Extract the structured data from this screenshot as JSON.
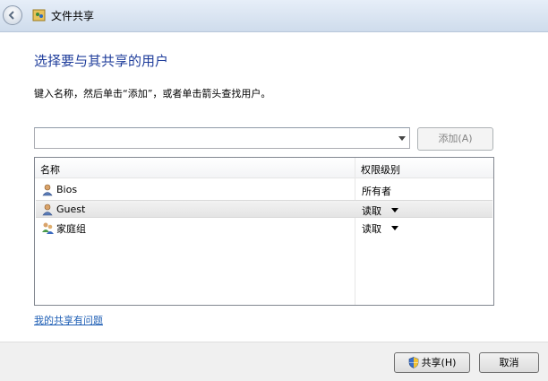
{
  "window": {
    "title": "文件共享"
  },
  "dialog": {
    "heading": "选择要与其共享的用户",
    "instruction": "键入名称，然后单击“添加”，或者单击箭头查找用户。",
    "combo_value": "",
    "add_button": "添加(A)",
    "columns": {
      "name": "名称",
      "permission": "权限级别"
    },
    "rows": [
      {
        "name": "Bios",
        "permission": "所有者",
        "icon": "user-icon",
        "has_dropdown": false
      },
      {
        "name": "Guest",
        "permission": "读取",
        "icon": "user-icon",
        "has_dropdown": true,
        "selected": true
      },
      {
        "name": "家庭组",
        "permission": "读取",
        "icon": "homegroup-icon",
        "has_dropdown": true
      }
    ],
    "help_link": "我的共享有问题"
  },
  "footer": {
    "share_button": "共享(H)",
    "cancel_button": "取消"
  },
  "colors": {
    "heading": "#1f3d9b",
    "link": "#1f5fb5",
    "titlebar": "#dbe5f2"
  }
}
